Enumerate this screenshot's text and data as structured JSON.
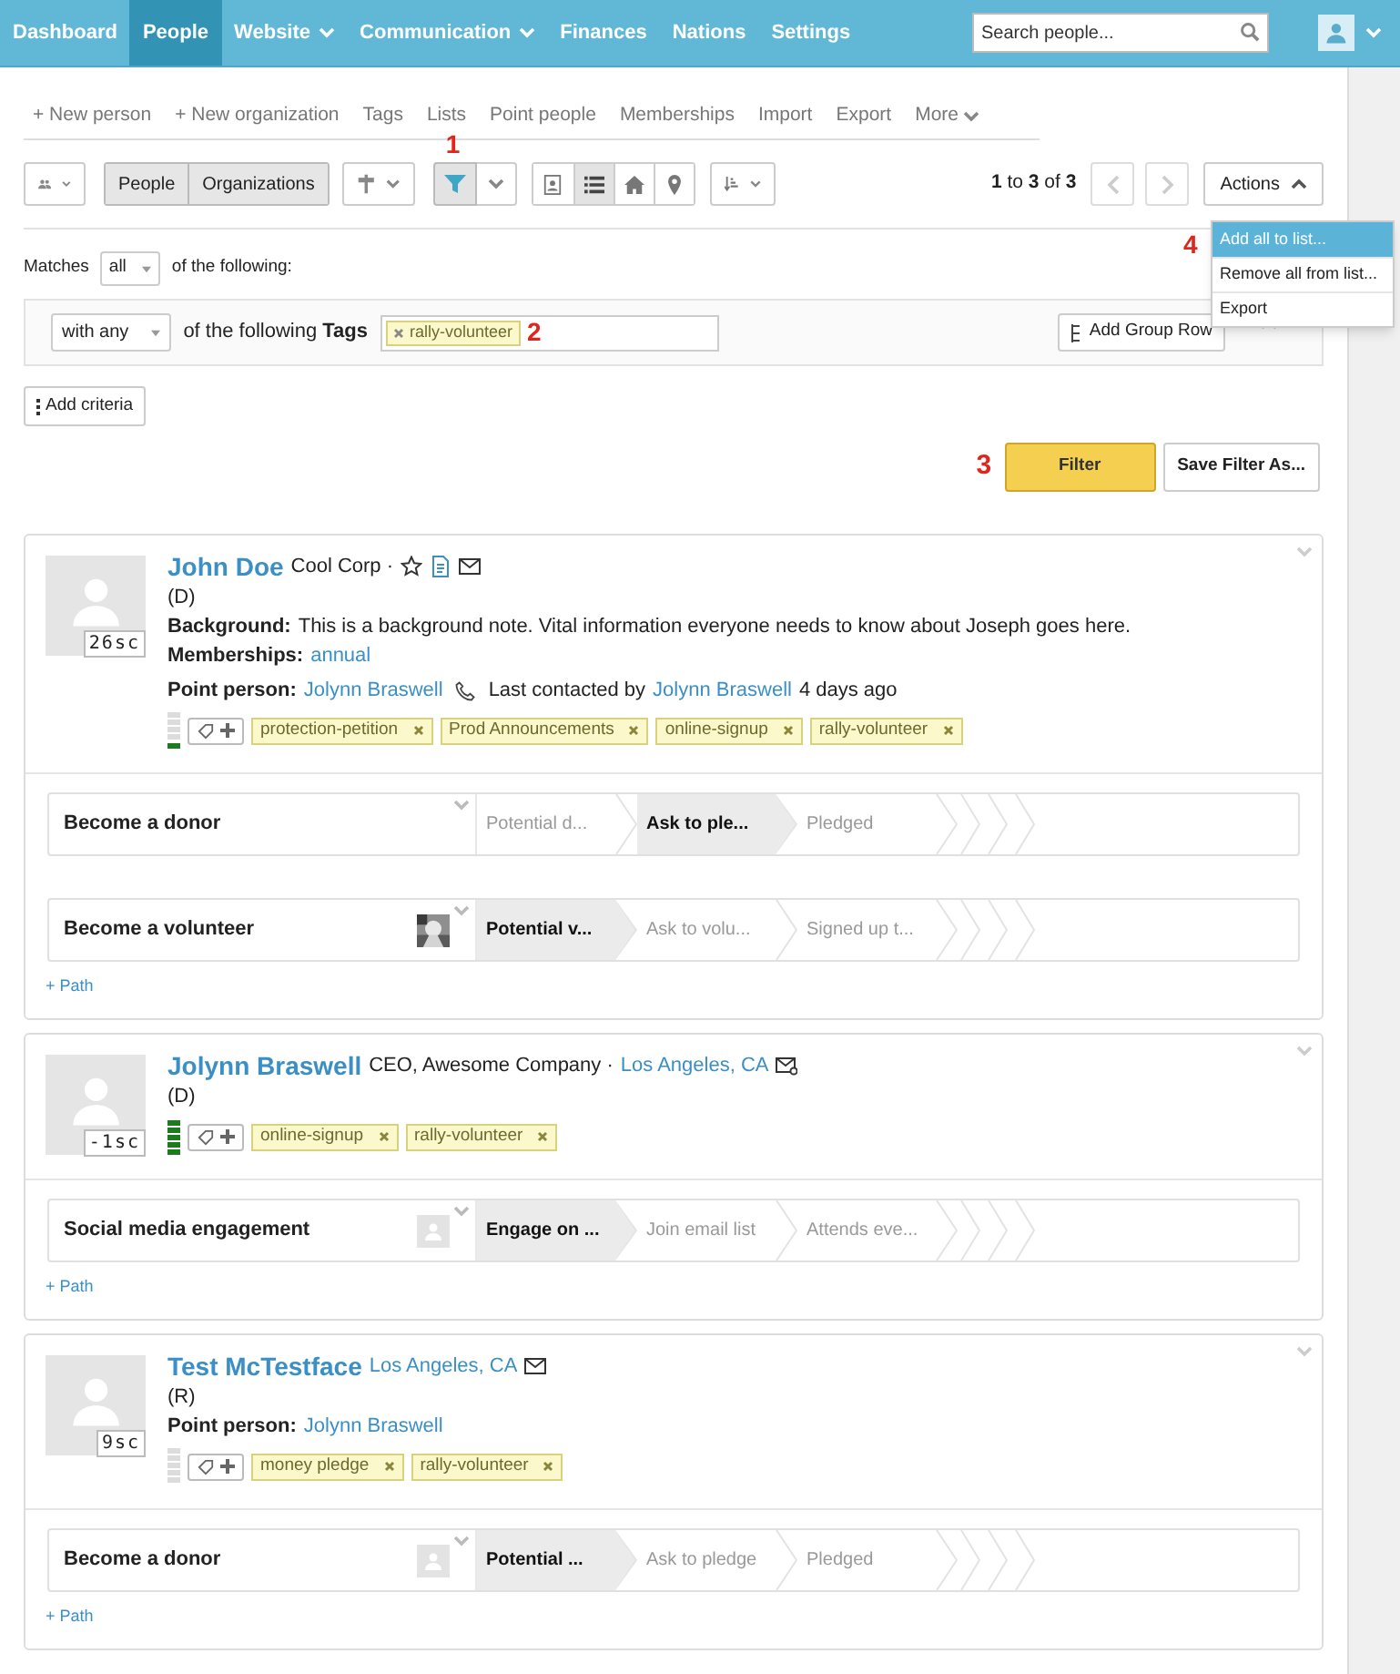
{
  "nav": {
    "items": [
      {
        "label": "Dashboard",
        "dropdown": false,
        "selected": false
      },
      {
        "label": "People",
        "dropdown": false,
        "selected": true
      },
      {
        "label": "Website",
        "dropdown": true,
        "selected": false
      },
      {
        "label": "Communication",
        "dropdown": true,
        "selected": false
      },
      {
        "label": "Finances",
        "dropdown": false,
        "selected": false
      },
      {
        "label": "Nations",
        "dropdown": false,
        "selected": false
      },
      {
        "label": "Settings",
        "dropdown": false,
        "selected": false
      }
    ],
    "search": {
      "placeholder": "Search people..."
    }
  },
  "subnav": {
    "items": [
      "+ New person",
      "+ New organization",
      "Tags",
      "Lists",
      "Point people",
      "Memberships",
      "Import",
      "Export"
    ],
    "more": "More"
  },
  "toolbar": {
    "segments": [
      "People",
      "Organizations"
    ],
    "filter_active": true,
    "filter_callout": "1",
    "views": [
      {
        "kind": "card",
        "selected": false
      },
      {
        "kind": "list",
        "selected": true
      },
      {
        "kind": "home",
        "selected": false
      },
      {
        "kind": "map",
        "selected": false
      }
    ],
    "pager": "**1** to **3** of **3**",
    "actions": {
      "label": "Actions",
      "expanded": true,
      "callout": "4",
      "menu": [
        {
          "label": "Add all to list...",
          "selected": true
        },
        {
          "label": "Remove all from list...",
          "selected": false
        },
        {
          "label": "Export",
          "selected": false
        }
      ]
    }
  },
  "filter": {
    "matches_label": "Matches",
    "matches_value": "all",
    "matches_suffix": "of the following:",
    "rows": [
      {
        "operator": "with any",
        "text": "of the following **Tags**",
        "tags": [
          "rally-volunteer"
        ],
        "callout": "2"
      }
    ],
    "add_group_row": "Add Group Row",
    "add_criteria": "Add criteria",
    "button_callout": "3",
    "filter_button": "Filter",
    "save_button": "Save Filter As..."
  },
  "people": [
    {
      "name": "John Doe",
      "subtitle": "Cool Corp ·",
      "icons": [
        {
          "kind": "star"
        },
        {
          "kind": "document"
        },
        {
          "kind": "mail"
        }
      ],
      "party": "(D)",
      "score": "26sc",
      "details": [
        {
          "label": "Background:",
          "value": "This is a background note. Vital information everyone needs to know about Joseph goes here.",
          "link": false
        },
        {
          "label": "Memberships:",
          "value": "annual",
          "link": true
        }
      ],
      "point_person": {
        "label": "Point person:",
        "name": "Jolynn Braswell",
        "contact_prefix": "Last contacted by",
        "contact_by": "Jolynn Braswell",
        "contact_when": "4 days ago"
      },
      "support": {
        "level": 0.2
      },
      "tags": [
        "protection-petition",
        "Prod Announcements",
        "online-signup",
        "rally-volunteer"
      ],
      "paths": [
        {
          "title": "Become a donor",
          "steps": [
            {
              "label": "Potential d...",
              "selected": false
            },
            {
              "label": "Ask to ple...",
              "selected": true
            },
            {
              "label": "Pledged",
              "selected": false
            }
          ]
        },
        {
          "title": "Become a volunteer",
          "avatar": {
            "kind": "picture"
          },
          "steps": [
            {
              "label": "Potential v...",
              "selected": true
            },
            {
              "label": "Ask to volu...",
              "selected": false
            },
            {
              "label": "Signed up t...",
              "selected": false
            }
          ]
        }
      ],
      "add_path": "+ Path"
    },
    {
      "name": "Jolynn Braswell",
      "subtitle": "CEO, Awesome Company ·",
      "location": "Los Angeles, CA",
      "icons": [
        {
          "kind": "mail-gear"
        }
      ],
      "party": "(D)",
      "score": "-1sc",
      "support": {
        "level": 1
      },
      "tags": [
        "online-signup",
        "rally-volunteer"
      ],
      "paths": [
        {
          "title": "Social media engagement",
          "avatar": {
            "kind": "placeholder"
          },
          "steps": [
            {
              "label": "Engage on ...",
              "selected": true
            },
            {
              "label": "Join email list",
              "selected": false
            },
            {
              "label": "Attends eve...",
              "selected": false
            }
          ]
        }
      ],
      "add_path": "+ Path"
    },
    {
      "name": "Test McTestface",
      "location": "Los Angeles, CA",
      "icons": [
        {
          "kind": "mail"
        }
      ],
      "party": "(R)",
      "score": "9sc",
      "point_person": {
        "label": "Point person:",
        "name": "Jolynn Braswell"
      },
      "support": {
        "level": 0
      },
      "tags": [
        "money pledge",
        "rally-volunteer"
      ],
      "paths": [
        {
          "title": "Become a donor",
          "avatar": {
            "kind": "placeholder"
          },
          "steps": [
            {
              "label": "Potential ...",
              "selected": true
            },
            {
              "label": "Ask to pledge",
              "selected": false
            },
            {
              "label": "Pledged",
              "selected": false
            }
          ]
        }
      ],
      "add_path": "+ Path"
    }
  ]
}
